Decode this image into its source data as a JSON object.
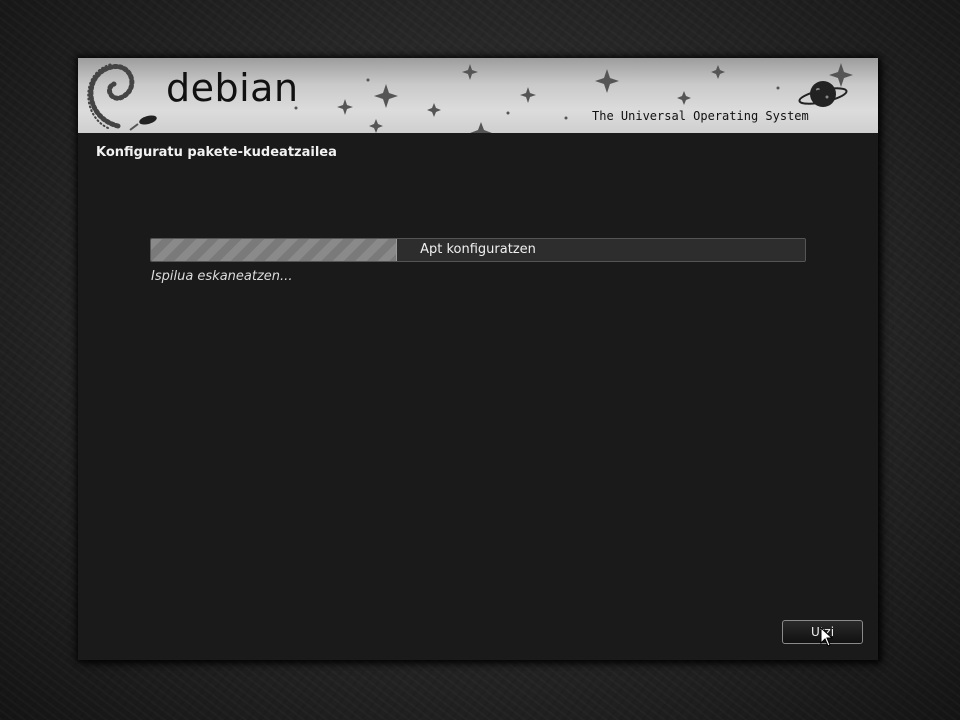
{
  "banner": {
    "logo_text": "debian",
    "tagline": "The Universal Operating System"
  },
  "page": {
    "title": "Konfiguratu pakete-kudeatzailea"
  },
  "progress": {
    "label": "Apt konfiguratzen",
    "fraction": 0.375
  },
  "status": {
    "text": "Ispilua eskaneatzen..."
  },
  "buttons": {
    "quit_label": "Utzi"
  },
  "colors": {
    "background": "#262626",
    "window": "#1a1a1a",
    "banner": "#d0d0d0",
    "progress_fill": "#8a8a8a",
    "text": "#f0f0f0"
  }
}
